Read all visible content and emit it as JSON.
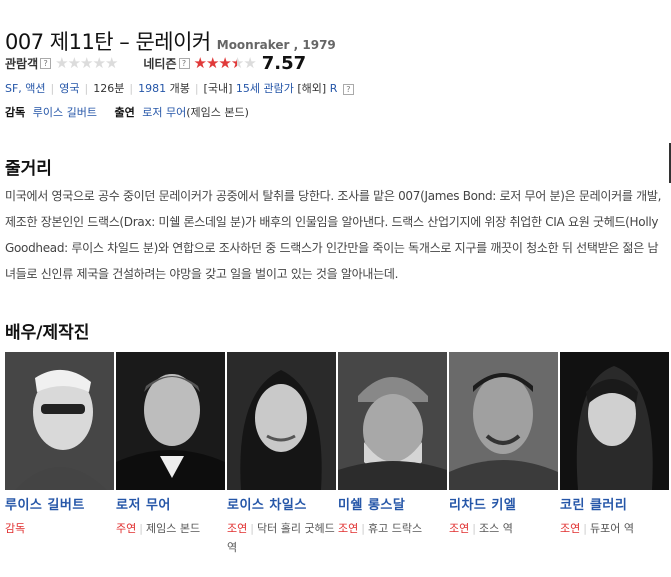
{
  "movie": {
    "title": "007 제11탄 – 문레이커",
    "original_title": "Moonraker , 1979"
  },
  "ratings": {
    "audience_label": "관람객",
    "netizen_label": "네티즌",
    "help_glyph": "?",
    "netizen_score": "7.57",
    "netizen_stars": 3.5,
    "audience_stars": 0
  },
  "meta": {
    "genre": "SF, 액션",
    "country": "영국",
    "runtime": "126분",
    "release_year": "1981",
    "release_label": "개봉",
    "rating_domestic_label": "[국내]",
    "rating_domestic": "15세 관람가",
    "rating_foreign_label": "[해외]",
    "rating_foreign": "R"
  },
  "credits": {
    "director_label": "감독",
    "director": "루이스 길버트",
    "cast_label": "출연",
    "cast_actor": "로저 무어",
    "cast_role": "(제임스 본드)"
  },
  "synopsis": {
    "heading": "줄거리",
    "text": "미국에서 영국으로 공수 중이던 문레이커가 공중에서 탈취를 당한다. 조사를 맡은 007(James Bond: 로저 무어 분)은 문레이커를 개발, 제조한 장본인인 드랙스(Drax: 미쉘 론스데일 분)가 배후의 인물임을 알아낸다. 드랙스 산업기지에 위장 취업한 CIA 요원 굿헤드(Holly Goodhead: 루이스 차일드 분)와 연합으로 조사하던 중 드랙스가 인간만을 죽이는 독개스로 지구를 깨끗이 청소한 뒤 선택받은 젊은 남녀들로 신인류 제국을 건설하려는 야망을 갖고 일을 벌이고 있는 것을 알아내는데."
  },
  "cast_section": {
    "heading": "배우/제작진",
    "people": [
      {
        "name": "루이스 길버트",
        "type": "감독",
        "role": ""
      },
      {
        "name": "로저 무어",
        "type": "주연",
        "role": "제임스 본드"
      },
      {
        "name": "로이스 차일스",
        "type": "조연",
        "role": "닥터 홀리 굿헤드 역"
      },
      {
        "name": "미쉘 롱스달",
        "type": "조연",
        "role": "휴고 드락스"
      },
      {
        "name": "리차드 키엘",
        "type": "조연",
        "role": "조스 역"
      },
      {
        "name": "코린 클러리",
        "type": "조연",
        "role": "듀포어 역"
      }
    ]
  },
  "colors": {
    "link": "#2556a8",
    "star_on": "#e03a3a",
    "role_type": "#e02e2e"
  }
}
